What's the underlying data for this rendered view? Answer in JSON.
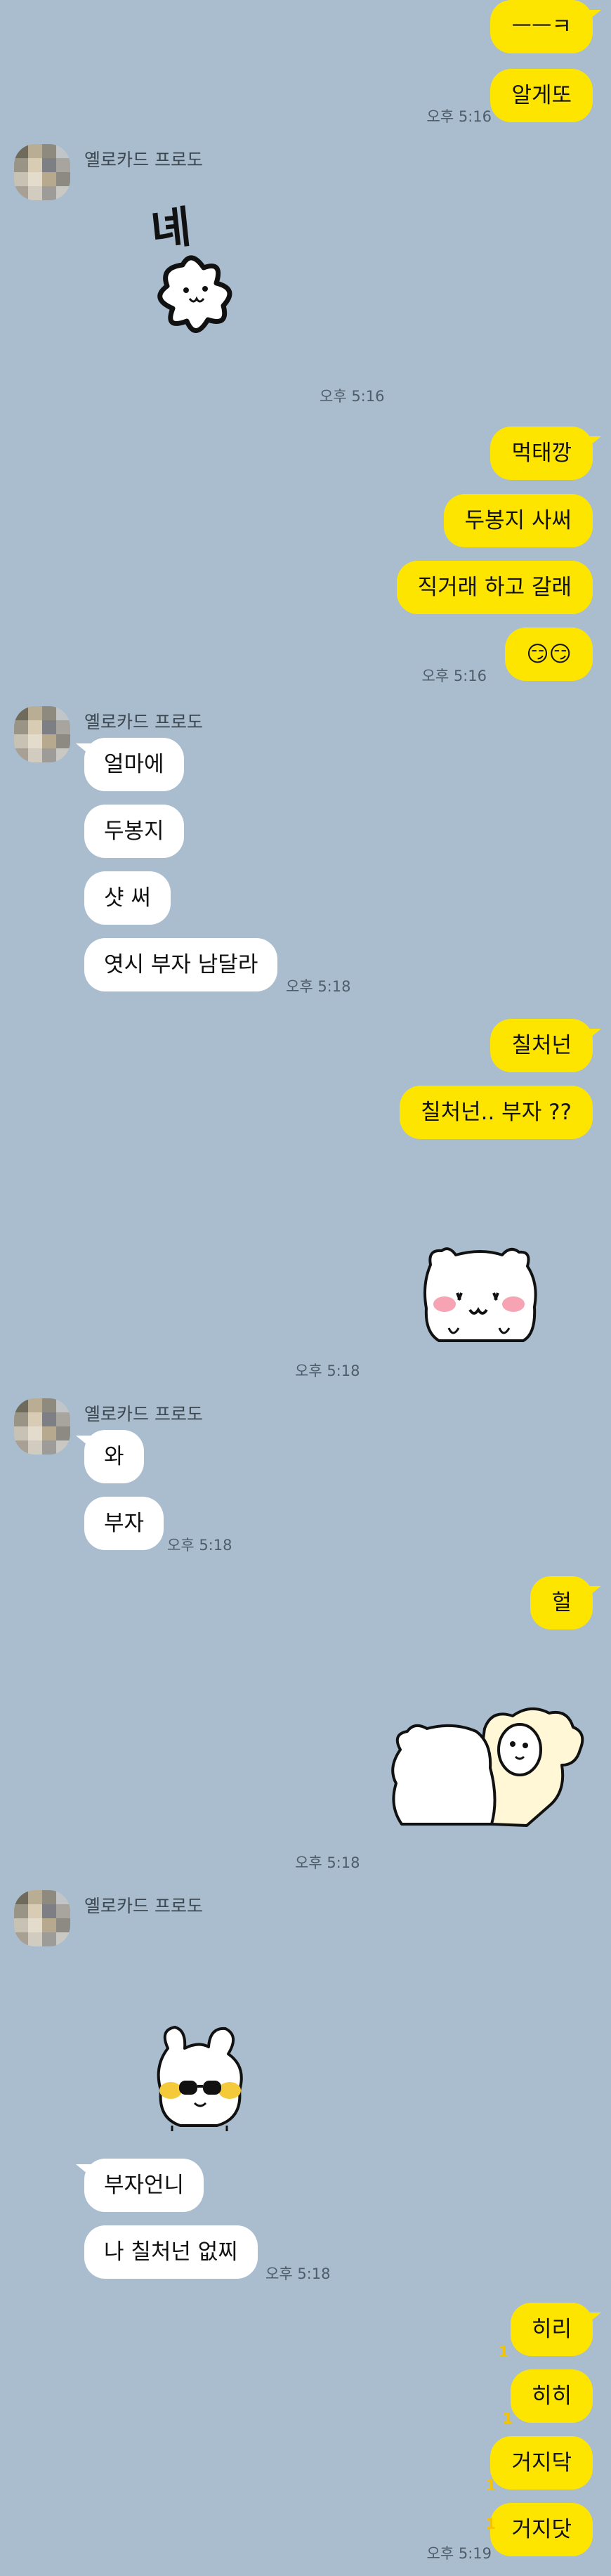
{
  "sender_name": "옐로카드 프로도",
  "messages": {
    "m1": "ㅡㅡㅋ",
    "m2": "알게또",
    "t1": "오후 5:16",
    "t2": "오후 5:16",
    "m3": "먹태깡",
    "m4": "두봉지 사써",
    "m5": "직거래 하고 갈래",
    "m6": "😏😏",
    "t3": "오후 5:16",
    "o1": "얼마에",
    "o2": "두봉지",
    "o3": "샷 써",
    "o4": "엿시 부자 남달라",
    "t4": "오후 5:18",
    "m7": "칠처넌",
    "m8": "칠처넌.. 부자 ??",
    "t5": "오후 5:18",
    "o5": "와",
    "o6": "부자",
    "t6": "오후 5:18",
    "m9": "헐",
    "t7": "오후 5:18",
    "o7": "부자언니",
    "o8": "나 칠처넌 없찌",
    "t8": "오후 5:18",
    "m10": "히리",
    "m11": "히히",
    "m12": "거지닥",
    "m13": "거지닷",
    "t9": "오후 5:19",
    "unread": "1",
    "sticker1_text": "녜"
  }
}
